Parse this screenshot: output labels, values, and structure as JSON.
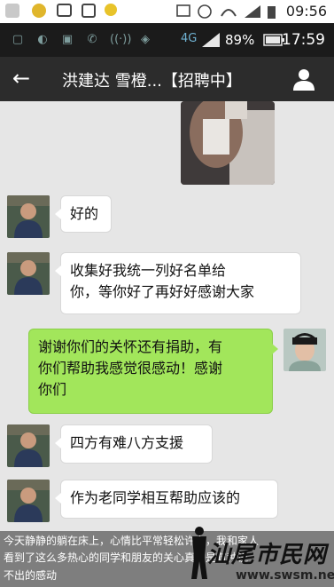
{
  "outer_status": {
    "time": "09:56"
  },
  "inner_status": {
    "network": "4G",
    "battery": "89%",
    "time": "17:59"
  },
  "titlebar": {
    "back_icon": "arrow-left",
    "title": "洪建达 雪橙...【招聘中】",
    "profile_icon": "person"
  },
  "messages": [
    {
      "side": "left",
      "text": "好的"
    },
    {
      "side": "left",
      "lines": [
        "收集好我统一列好名单给",
        "你，等你好了再好好感谢大家"
      ]
    },
    {
      "side": "right",
      "lines": [
        "谢谢你们的关怀还有捐助，有",
        "你们帮助我感觉很感动！感谢",
        "你们"
      ]
    },
    {
      "side": "left",
      "text": "四方有难八方支援"
    },
    {
      "side": "left",
      "text": "作为老同学相互帮助应该的"
    }
  ],
  "caption": {
    "line1": "今天静静的躺在床上，心情比平常轻松许多，我和家人",
    "line2": "看到了这么多热心的同学和朋友的关心真的是有种说",
    "line3": "不出的感动"
  },
  "watermark": {
    "logo": "汕尾市民网",
    "url": "www.swsm.net"
  },
  "colors": {
    "titlebar": "#2c2c2c",
    "chat_bg": "#e6e6e6",
    "outgoing_bubble": "#a2e65b"
  }
}
